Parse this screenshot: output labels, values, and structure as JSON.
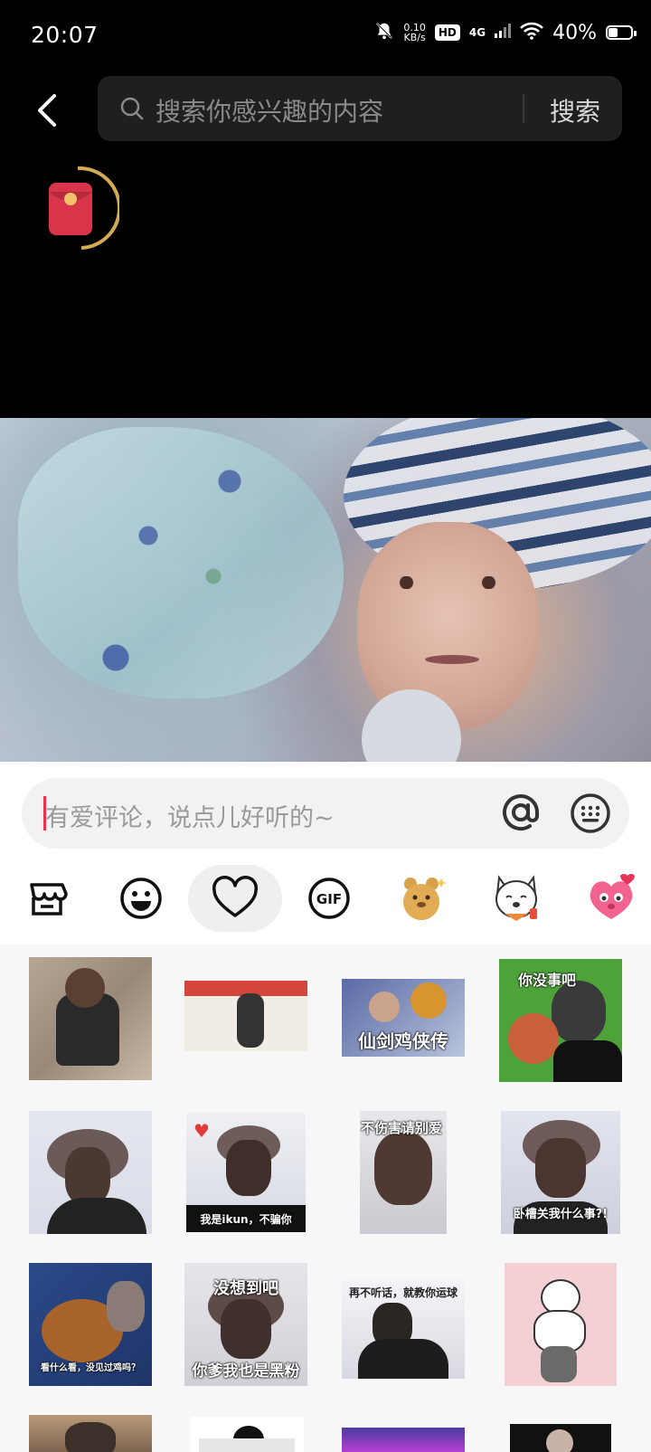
{
  "status_bar": {
    "time": "20:07",
    "net_speed_value": "0.10",
    "net_speed_unit": "KB/s",
    "hd": "HD",
    "network": "4G",
    "battery_pct": "40%",
    "battery_level": 0.4
  },
  "search": {
    "placeholder": "搜索你感兴趣的内容",
    "button": "搜索"
  },
  "comment": {
    "placeholder": "有爱评论，说点儿好听的~"
  },
  "emoji_tabs": [
    {
      "name": "store-icon",
      "selected": false
    },
    {
      "name": "smiley-icon",
      "selected": false
    },
    {
      "name": "heart-icon",
      "selected": true
    },
    {
      "name": "gif-icon",
      "selected": false
    },
    {
      "name": "bear-sticker-icon",
      "selected": false
    },
    {
      "name": "dog-sticker-icon",
      "selected": false
    },
    {
      "name": "pink-octopus-sticker-icon",
      "selected": false
    }
  ],
  "stickers": {
    "s4": "你没事吧",
    "s5": "仙剑鸡侠传",
    "s7": "我是ikun，不骗你",
    "s8": "不伤害请别爱",
    "s9": "卧槽关我什么事?!",
    "s10": "看什么看，没见过鸡吗？",
    "s11a": "没想到吧",
    "s11b": "你爹我也是黑粉",
    "s12": "再不听话，就教你运球"
  },
  "colors": {
    "accent_caret": "#e8334a",
    "redpacket": "#d8344a",
    "redpacket_ring": "#d4aa55"
  }
}
